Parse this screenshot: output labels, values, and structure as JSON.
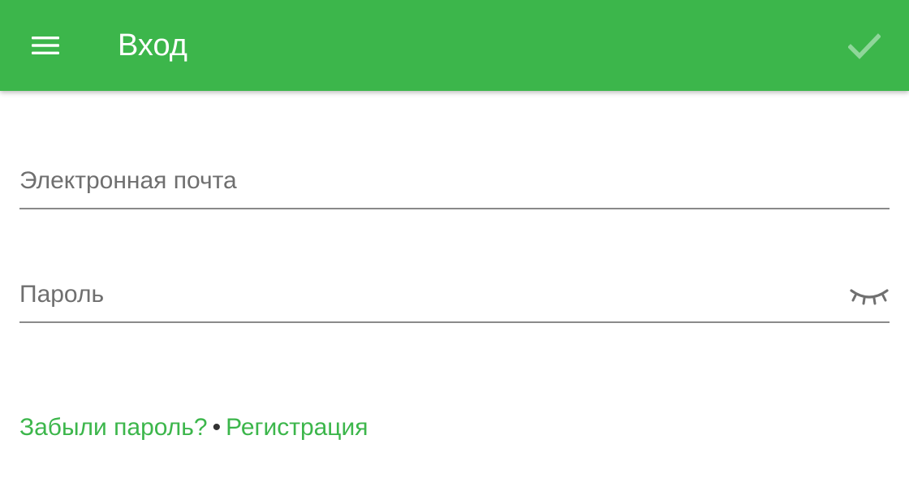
{
  "colors": {
    "primary": "#3cb64b",
    "on_primary": "#ffffff",
    "confirm_disabled": "#8fd69a",
    "field_line": "#8a8a8a",
    "placeholder": "#6f6f6f",
    "link": "#3cb64b"
  },
  "appbar": {
    "menu_icon": "hamburger-menu-icon",
    "title": "Вход",
    "confirm_icon": "checkmark-icon"
  },
  "form": {
    "email": {
      "placeholder": "Электронная почта",
      "value": ""
    },
    "password": {
      "placeholder": "Пароль",
      "value": "",
      "toggle_icon": "eye-closed-icon"
    }
  },
  "links": {
    "forgot_password": "Забыли пароль?",
    "separator": "•",
    "register": "Регистрация"
  }
}
